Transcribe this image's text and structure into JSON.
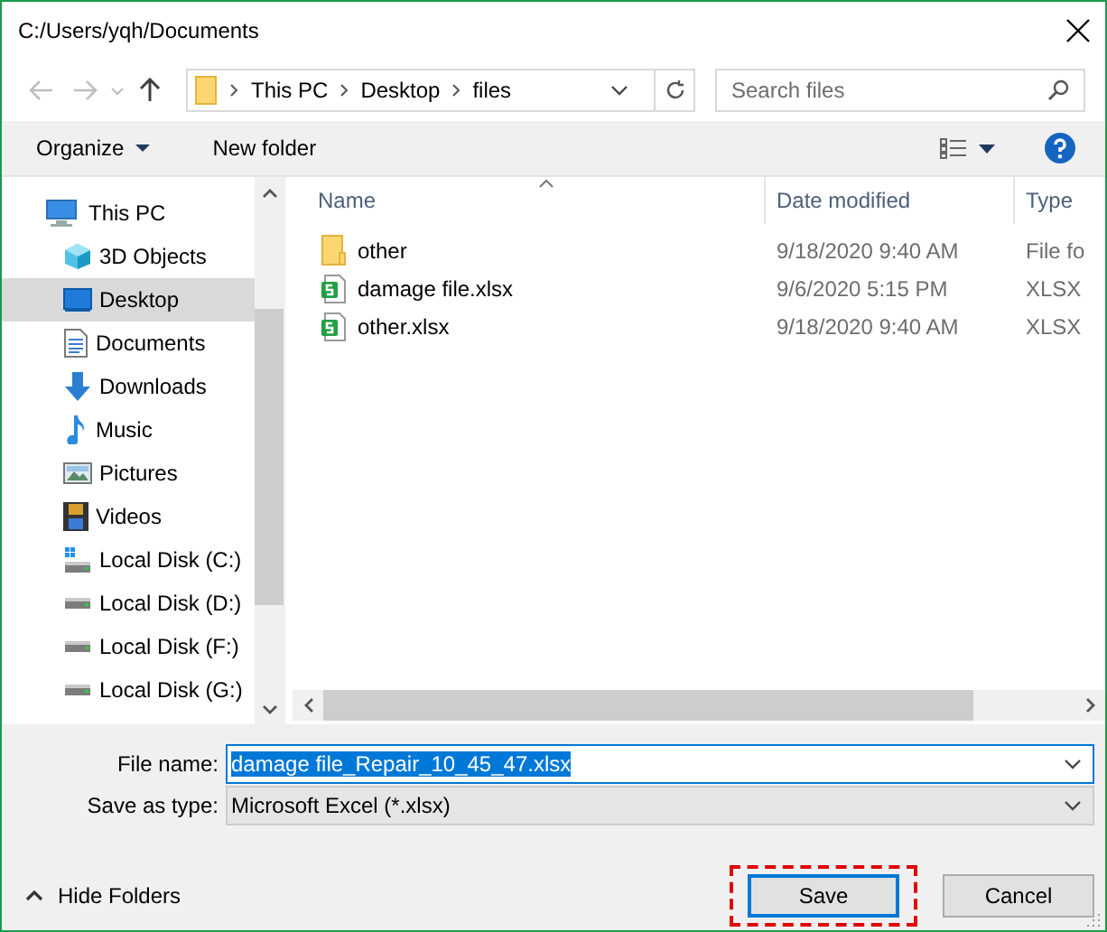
{
  "window": {
    "title": "C:/Users/yqh/Documents"
  },
  "navigation": {
    "back": {
      "disabled": true
    },
    "forward": {
      "disabled": true
    },
    "up": {
      "disabled": false
    }
  },
  "address": {
    "crumbs": [
      "This PC",
      "Desktop",
      "files"
    ]
  },
  "search": {
    "placeholder": "Search files"
  },
  "toolbar": {
    "organize": "Organize",
    "new_folder": "New folder"
  },
  "sidebar": {
    "items": [
      {
        "label": "This PC",
        "kind": "pc",
        "selected": false,
        "children": [
          {
            "label": "3D Objects",
            "kind": "objects3d",
            "selected": false
          },
          {
            "label": "Desktop",
            "kind": "desktop",
            "selected": true
          },
          {
            "label": "Documents",
            "kind": "documents",
            "selected": false
          },
          {
            "label": "Downloads",
            "kind": "downloads",
            "selected": false
          },
          {
            "label": "Music",
            "kind": "music",
            "selected": false
          },
          {
            "label": "Pictures",
            "kind": "pictures",
            "selected": false
          },
          {
            "label": "Videos",
            "kind": "videos",
            "selected": false
          },
          {
            "label": "Local Disk (C:)",
            "kind": "system_drive",
            "selected": false
          },
          {
            "label": "Local Disk (D:)",
            "kind": "drive",
            "selected": false
          },
          {
            "label": "Local Disk (F:)",
            "kind": "drive",
            "selected": false
          },
          {
            "label": "Local Disk (G:)",
            "kind": "drive",
            "selected": false
          }
        ]
      }
    ]
  },
  "table": {
    "columns": [
      "Name",
      "Date modified",
      "Type"
    ],
    "rows": [
      {
        "kind": "folder",
        "name": "other",
        "date": "9/18/2020 9:40 AM",
        "type": "File fo"
      },
      {
        "kind": "xlsx",
        "name": "damage file.xlsx",
        "date": "9/6/2020 5:15 PM",
        "type": "XLSX"
      },
      {
        "kind": "xlsx",
        "name": "other.xlsx",
        "date": "9/18/2020 9:40 AM",
        "type": "XLSX"
      }
    ]
  },
  "file_name": {
    "label": "File name:",
    "value": "damage file_Repair_10_45_47.xlsx",
    "text_selected": true
  },
  "save_type": {
    "label": "Save as type:",
    "value": "Microsoft Excel (*.xlsx)"
  },
  "hide_folders": "Hide Folders",
  "buttons": [
    {
      "kind": "save",
      "label": "Save",
      "highlighted": true
    },
    {
      "kind": "cancel",
      "label": "Cancel",
      "highlighted": false
    }
  ]
}
